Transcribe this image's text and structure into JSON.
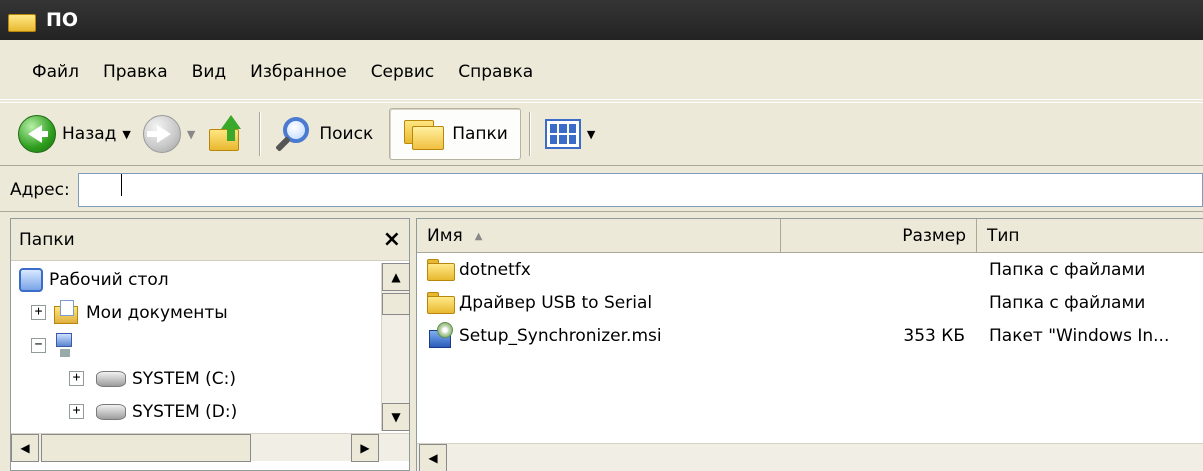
{
  "window": {
    "title": "ПО"
  },
  "menu": [
    "Файл",
    "Правка",
    "Вид",
    "Избранное",
    "Сервис",
    "Справка"
  ],
  "toolbar": {
    "back_label": "Назад",
    "search_label": "Поиск",
    "folders_label": "Папки"
  },
  "address": {
    "label": "Адрес:",
    "value": ""
  },
  "folders_pane": {
    "header": "Папки",
    "close_glyph": "×",
    "tree": [
      {
        "label": "Рабочий стол"
      },
      {
        "label": "Мои документы",
        "expander": "+"
      },
      {
        "label": "",
        "expander": "−"
      },
      {
        "label": "SYSTEM (C:)",
        "expander": "+"
      },
      {
        "label": "SYSTEM (D:)",
        "expander": "+"
      }
    ]
  },
  "file_list": {
    "columns": {
      "name": "Имя",
      "size": "Размер",
      "type": "Тип"
    },
    "rows": [
      {
        "name": "dotnetfx",
        "size": "",
        "type": "Папка с файлами"
      },
      {
        "name": "Драйвер USB to Serial",
        "size": "",
        "type": "Папка с файлами"
      },
      {
        "name": "Setup_Synchronizer.msi",
        "size": "353 КБ",
        "type": "Пакет \"Windows In..."
      }
    ]
  },
  "icons": {
    "title": "folder-icon",
    "back": "back-arrow-icon",
    "forward": "forward-arrow-icon",
    "up": "folder-up-icon",
    "search": "search-icon",
    "folders": "folders-icon",
    "views": "views-icon"
  }
}
